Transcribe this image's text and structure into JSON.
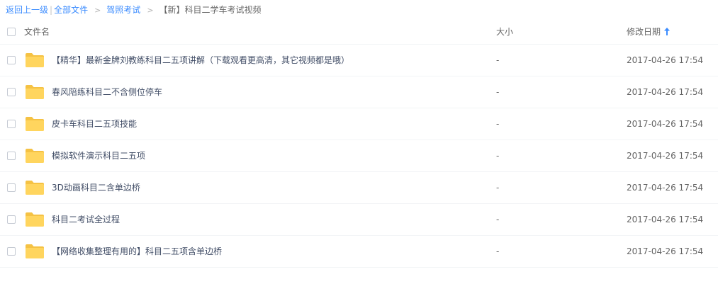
{
  "breadcrumb": {
    "back": "返回上一级",
    "separator": "|",
    "all_files": "全部文件",
    "arrow": ">",
    "parent": "驾照考试",
    "current": "【新】科目二学车考试视频"
  },
  "table": {
    "headers": {
      "name": "文件名",
      "size": "大小",
      "modified": "修改日期"
    },
    "sort_icon": "arrow-up-icon",
    "rows": [
      {
        "name": "【精华】最新金牌刘教练科目二五项讲解（下载观看更高清，其它视频都是哦）",
        "size": "-",
        "modified": "2017-04-26 17:54"
      },
      {
        "name": "春风陪练科目二不含侧位停车",
        "size": "-",
        "modified": "2017-04-26 17:54"
      },
      {
        "name": "皮卡车科目二五项技能",
        "size": "-",
        "modified": "2017-04-26 17:54"
      },
      {
        "name": "模拟软件演示科目二五项",
        "size": "-",
        "modified": "2017-04-26 17:54"
      },
      {
        "name": "3D动画科目二含单边桥",
        "size": "-",
        "modified": "2017-04-26 17:54"
      },
      {
        "name": "科目二考试全过程",
        "size": "-",
        "modified": "2017-04-26 17:54"
      },
      {
        "name": "【网络收集整理有用的】科目二五项含单边桥",
        "size": "-",
        "modified": "2017-04-26 17:54"
      }
    ]
  },
  "colors": {
    "link": "#3b8cff",
    "folder": "#ffd55e",
    "folder_tab": "#f5c244",
    "text": "#424e67"
  }
}
